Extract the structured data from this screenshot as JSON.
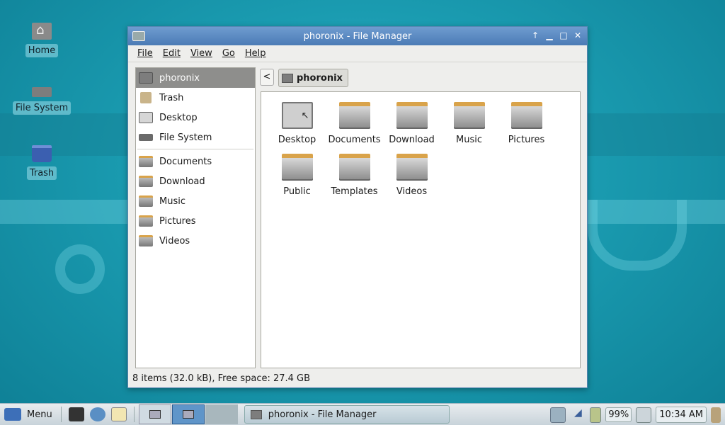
{
  "desktop": {
    "icons": [
      {
        "label": "Home",
        "icon": "home-icon"
      },
      {
        "label": "File System",
        "icon": "drive-icon"
      },
      {
        "label": "Trash",
        "icon": "trash-icon"
      }
    ]
  },
  "window": {
    "title": "phoronix - File Manager",
    "menu": [
      "File",
      "Edit",
      "View",
      "Go",
      "Help"
    ],
    "sidebar": {
      "places": [
        {
          "label": "phoronix",
          "icon": "home-folder-icon",
          "active": true
        },
        {
          "label": "Trash",
          "icon": "trash-icon"
        },
        {
          "label": "Desktop",
          "icon": "desktop-icon"
        },
        {
          "label": "File System",
          "icon": "drive-icon"
        }
      ],
      "bookmarks": [
        {
          "label": "Documents",
          "icon": "folder-icon"
        },
        {
          "label": "Download",
          "icon": "folder-icon"
        },
        {
          "label": "Music",
          "icon": "folder-icon"
        },
        {
          "label": "Pictures",
          "icon": "folder-icon"
        },
        {
          "label": "Videos",
          "icon": "folder-icon"
        }
      ]
    },
    "pathbar": {
      "back": "<",
      "current": "phoronix"
    },
    "files": [
      {
        "name": "Desktop",
        "type": "desktop"
      },
      {
        "name": "Documents",
        "type": "folder"
      },
      {
        "name": "Download",
        "type": "folder"
      },
      {
        "name": "Music",
        "type": "folder"
      },
      {
        "name": "Pictures",
        "type": "folder"
      },
      {
        "name": "Public",
        "type": "folder"
      },
      {
        "name": "Templates",
        "type": "folder"
      },
      {
        "name": "Videos",
        "type": "folder"
      }
    ],
    "status": "8 items (32.0 kB), Free space: 27.4 GB"
  },
  "taskbar": {
    "menu_label": "Menu",
    "task_label": "phoronix - File Manager",
    "battery": "99%",
    "clock": "10:34 AM"
  },
  "colors": {
    "titlebar": "#5b8ac4",
    "desktop": "#1a9bb0",
    "selection": "#8e8e8c"
  }
}
